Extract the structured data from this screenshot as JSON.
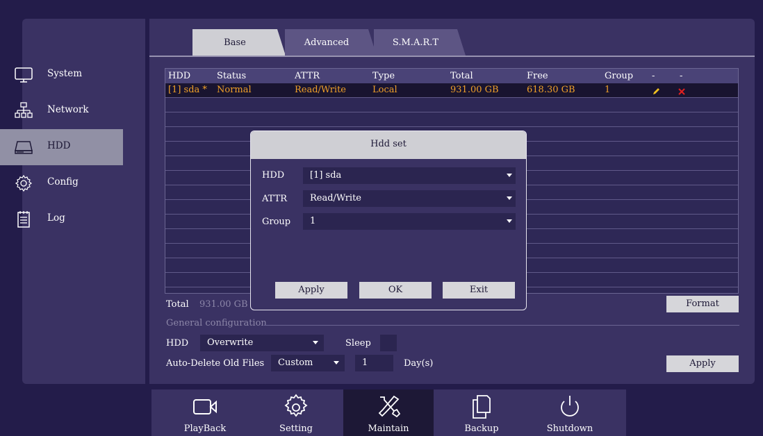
{
  "sidebar": {
    "items": [
      {
        "label": "System",
        "icon": "monitor-icon"
      },
      {
        "label": "Network",
        "icon": "network-icon"
      },
      {
        "label": "HDD",
        "icon": "hdd-icon"
      },
      {
        "label": "Config",
        "icon": "gear-icon"
      },
      {
        "label": "Log",
        "icon": "log-icon"
      }
    ],
    "active": "HDD"
  },
  "tabs": [
    {
      "label": "Base",
      "active": true
    },
    {
      "label": "Advanced",
      "active": false
    },
    {
      "label": "S.M.A.R.T",
      "active": false
    }
  ],
  "table": {
    "headers": [
      "HDD",
      "Status",
      "ATTR",
      "Type",
      "Total",
      "Free",
      "Group",
      "-",
      "-"
    ],
    "rows": [
      {
        "hdd": "[1] sda *",
        "status": "Normal",
        "attr": "Read/Write",
        "type": "Local",
        "total": "931.00 GB",
        "free": "618.30 GB",
        "group": "1",
        "edit_icon": "pencil-icon",
        "delete_icon": "close-icon"
      }
    ]
  },
  "summary": {
    "total_label": "Total",
    "total_value": "931.00 GB",
    "format_button": "Format"
  },
  "general": {
    "section_label": "General configuration",
    "hdd_label": "HDD",
    "hdd_mode": "Overwrite",
    "sleep_label": "Sleep",
    "auto_delete_label": "Auto-Delete Old Files",
    "auto_delete_mode": "Custom",
    "days_value": "1",
    "days_unit": "Day(s)",
    "apply_button": "Apply"
  },
  "dialog": {
    "title": "Hdd set",
    "hdd_label": "HDD",
    "hdd_value": "[1] sda",
    "attr_label": "ATTR",
    "attr_value": "Read/Write",
    "group_label": "Group",
    "group_value": "1",
    "apply_button": "Apply",
    "ok_button": "OK",
    "exit_button": "Exit"
  },
  "bottom_nav": [
    {
      "label": "PlayBack",
      "icon": "camera-icon"
    },
    {
      "label": "Setting",
      "icon": "gear-icon"
    },
    {
      "label": "Maintain",
      "icon": "tools-icon",
      "active": true
    },
    {
      "label": "Backup",
      "icon": "copy-icon"
    },
    {
      "label": "Shutdown",
      "icon": "power-icon"
    }
  ],
  "colors": {
    "background": "#231c4a",
    "panel": "#3a3263",
    "active_sidebar": "#9190a5",
    "highlight_text": "#f0a028",
    "delete_red": "#e02020",
    "edit_yellow": "#f0c020"
  }
}
